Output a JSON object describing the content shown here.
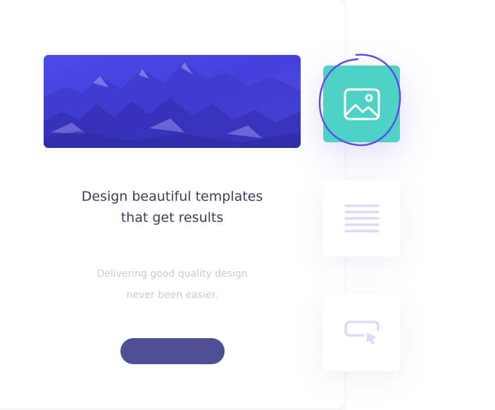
{
  "hero": {
    "image_icon": "mountain-landscape-image"
  },
  "content": {
    "title": "Design beautiful templates\nthat get results",
    "subtitle": "Delivering good quality design\nnever been easier.",
    "cta_label": ""
  },
  "tools": [
    {
      "name": "image-tool",
      "icon": "image-icon",
      "active": true
    },
    {
      "name": "text-tool",
      "icon": "text-lines-icon",
      "active": false
    },
    {
      "name": "button-tool",
      "icon": "button-cursor-icon",
      "active": false
    }
  ],
  "colors": {
    "accent_teal": "#4ed2c5",
    "brand_indigo": "#4f4f95",
    "highlight_purple": "#5b4fe8",
    "hero_blue": "#4b46e6",
    "muted_lavender": "#dcdafb"
  }
}
